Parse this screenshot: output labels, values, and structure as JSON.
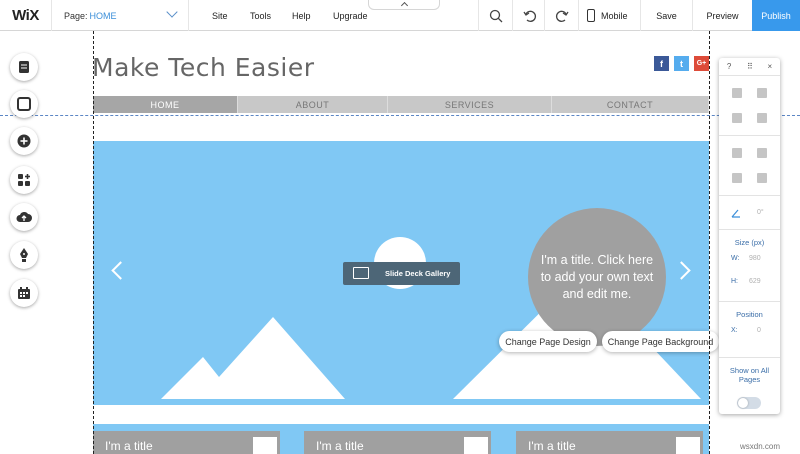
{
  "topbar": {
    "logo": "WiX",
    "page_label": "Page:",
    "page_value": "HOME",
    "menu": [
      "Site",
      "Tools",
      "Help",
      "Upgrade"
    ],
    "mobile": "Mobile",
    "save": "Save",
    "preview": "Preview",
    "publish": "Publish"
  },
  "site": {
    "title": "Make Tech Easier",
    "nav": [
      "HOME",
      "ABOUT",
      "SERVICES",
      "CONTACT"
    ],
    "social": {
      "facebook": "f",
      "twitter": "t",
      "googleplus": "G+"
    },
    "hero_text": "I'm a title. Click here to add your own text and edit me.",
    "gallery_label": "Slide Deck Gallery",
    "change_design": "Change Page Design",
    "change_background": "Change Page Background",
    "bottom_boxes": [
      "I'm a title",
      "I'm a title",
      "I'm a title"
    ]
  },
  "right_panel": {
    "help": "?",
    "close": "×",
    "rotation": "0°",
    "size_label": "Size (px)",
    "w_label": "W:",
    "w_value": "980",
    "h_label": "H:",
    "h_value": "629",
    "position_label": "Position",
    "x_label": "X:",
    "x_value": "0",
    "show_all_label": "Show on All Pages"
  },
  "watermark": "wsxdn.com",
  "colors": {
    "publish": "#3899ec",
    "hero": "#80c8f4",
    "title_circle": "#a0a0a0",
    "facebook": "#3b5998",
    "twitter": "#55acee",
    "googleplus": "#dd4b39"
  }
}
